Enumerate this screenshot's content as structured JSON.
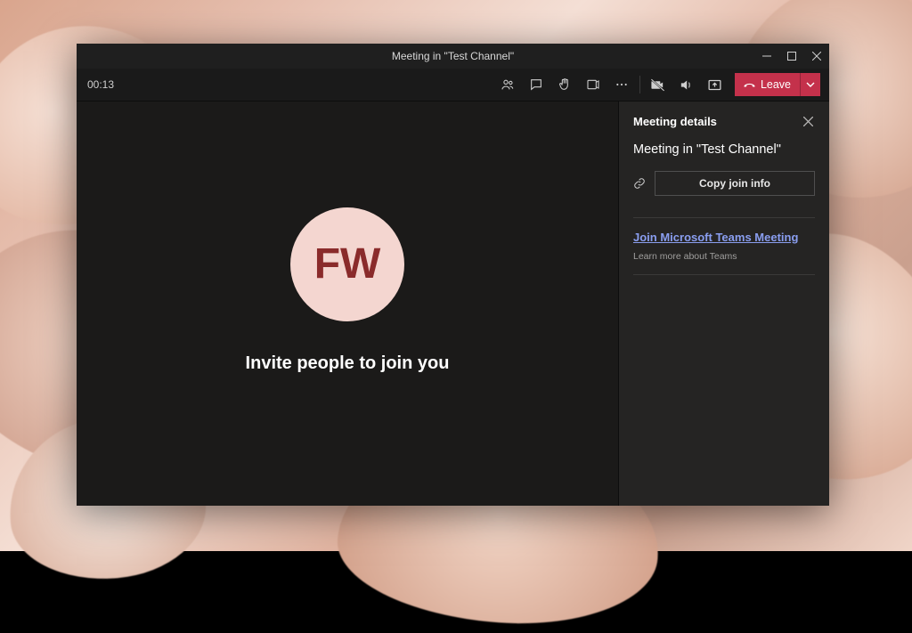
{
  "window_title": "Meeting in \"Test Channel\"",
  "timer": "00:13",
  "leave_label": "Leave",
  "avatar_initials": "FW",
  "invite_prompt": "Invite people to join you",
  "sidepanel": {
    "title": "Meeting details",
    "meeting_name": "Meeting in \"Test Channel\"",
    "copy_button": "Copy join info",
    "join_link": "Join Microsoft Teams Meeting",
    "learn_more": "Learn more about Teams"
  }
}
